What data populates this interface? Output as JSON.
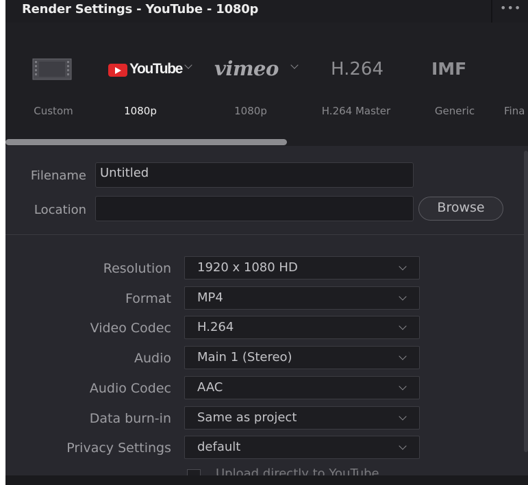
{
  "window": {
    "title": "Render Settings - YouTube - 1080p",
    "more_label": "•••"
  },
  "presets": [
    {
      "logo": "film-strip-icon",
      "label": "Custom"
    },
    {
      "logo": "youtube-logo",
      "logo_text": "YouTube",
      "label": "1080p",
      "active": true
    },
    {
      "logo": "vimeo-logo",
      "logo_text": "vimeo",
      "label": "1080p"
    },
    {
      "logo": "h264-text",
      "logo_text": "H.264",
      "label": "H.264 Master"
    },
    {
      "logo": "imf-text",
      "logo_text": "IMF",
      "label": "Generic"
    },
    {
      "label": "Fina"
    }
  ],
  "file": {
    "filename_label": "Filename",
    "filename_value": "Untitled",
    "location_label": "Location",
    "location_value": "",
    "browse_label": "Browse"
  },
  "settings": [
    {
      "label": "Resolution",
      "value": "1920 x 1080 HD"
    },
    {
      "label": "Format",
      "value": "MP4"
    },
    {
      "label": "Video Codec",
      "value": "H.264"
    },
    {
      "label": "Audio",
      "value": "Main 1 (Stereo)"
    },
    {
      "label": "Audio Codec",
      "value": "AAC"
    },
    {
      "label": "Data burn-in",
      "value": "Same as project"
    },
    {
      "label": "Privacy Settings",
      "value": "default"
    }
  ],
  "upload": {
    "label": "Upload directly to YouTube",
    "checked": false
  },
  "colors": {
    "panel_bg": "#28282e",
    "header_bg": "#1d1d21",
    "youtube_red": "#e0282a"
  }
}
